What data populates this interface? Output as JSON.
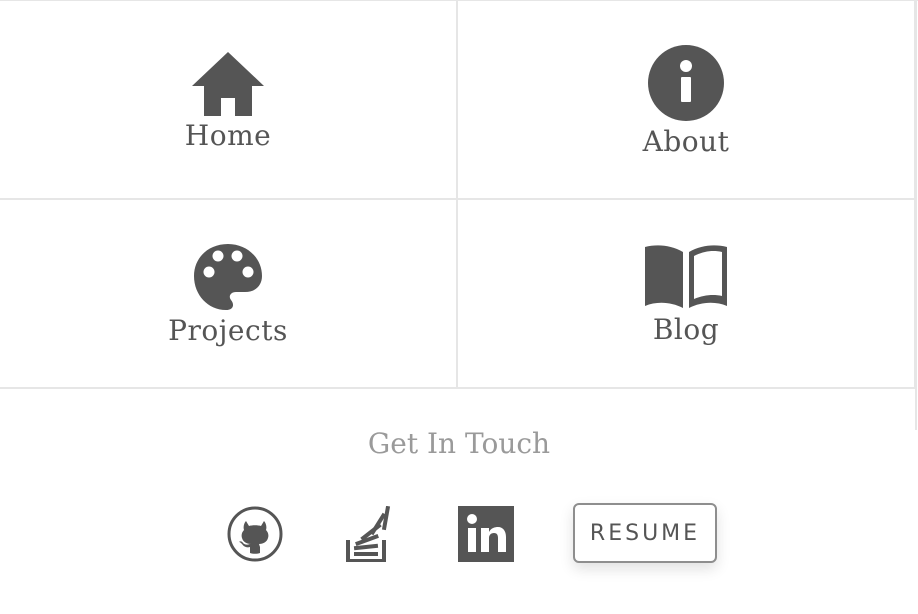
{
  "nav": {
    "home_label": "Home",
    "about_label": "About",
    "projects_label": "Projects",
    "blog_label": "Blog",
    "icons": {
      "home": "home-icon",
      "about": "info-icon",
      "projects": "palette-icon",
      "blog": "book-icon"
    }
  },
  "contact": {
    "title": "Get In Touch",
    "resume_label": "RESUME",
    "icons": {
      "github": "github-icon",
      "stack": "stack-overflow-icon",
      "linkedin": "linkedin-icon"
    }
  },
  "colors": {
    "icon": "#555555",
    "text": "#555555",
    "muted": "#9a9a9a",
    "divider": "#e6e6e6",
    "button_border": "#8e8e8e",
    "background": "#ffffff"
  }
}
